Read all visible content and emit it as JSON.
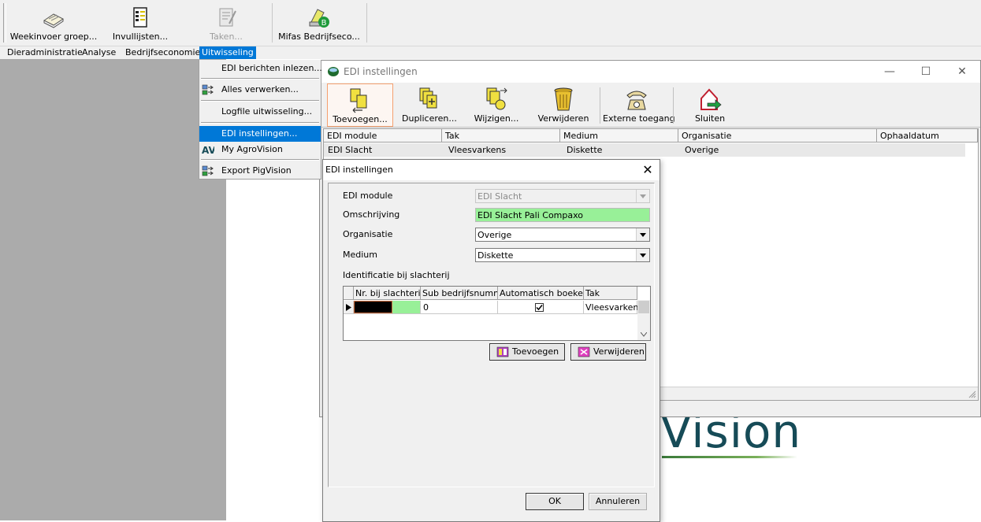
{
  "main_toolbar": {
    "buttons": [
      {
        "label": "Weekinvoer groep...",
        "icon": "book-icon",
        "enabled": true
      },
      {
        "label": "Invullijsten...",
        "icon": "clipboard-list-icon",
        "enabled": true
      },
      {
        "label": "Taken...",
        "icon": "notepad-pencil-icon",
        "enabled": false
      },
      {
        "label": "Mifas Bedrijfseco...",
        "icon": "mifas-b-icon",
        "enabled": true
      }
    ]
  },
  "menubar": {
    "items": [
      "Dieradministratie",
      "Analyse",
      "Bedrijfseconomie",
      "Uitwisseling"
    ],
    "active": "Uitwisseling"
  },
  "dropdown": {
    "items": [
      {
        "label": "EDI berichten inlezen...",
        "icon": ""
      },
      {
        "label": "Alles verwerken...",
        "icon": "process-icon"
      },
      {
        "label": "Logfile uitwisseling...",
        "icon": ""
      },
      {
        "label": "EDI instellingen...",
        "icon": "",
        "highlighted": true
      },
      {
        "label": "My AgroVision",
        "icon": "agrovision-av-icon"
      },
      {
        "label": "Export PigVision",
        "icon": "export-icon"
      }
    ]
  },
  "edi_window": {
    "title": "EDI instellingen",
    "toolbar": [
      {
        "label": "Toevoegen...",
        "icon": "add-document-icon"
      },
      {
        "label": "Dupliceren...",
        "icon": "duplicate-icon"
      },
      {
        "label": "Wijzigen...",
        "icon": "edit-icon"
      },
      {
        "label": "Verwijderen",
        "icon": "trash-bin-icon"
      },
      {
        "label": "Externe toegang",
        "icon": "telephone-icon"
      },
      {
        "label": "Sluiten",
        "icon": "exit-house-icon"
      }
    ],
    "grid": {
      "columns": [
        "EDI module",
        "Tak",
        "Medium",
        "Organisatie",
        "Ophaaldatum"
      ],
      "rows": [
        [
          "EDI Slacht",
          "Vleesvarkens",
          "Diskette",
          "Overige",
          ""
        ]
      ]
    }
  },
  "logo": {
    "text": "Vision"
  },
  "dialog": {
    "title": "EDI instellingen",
    "fields": {
      "edi_module": {
        "label": "EDI module",
        "value": "EDI Slacht"
      },
      "omschrijving": {
        "label": "Omschrijving",
        "value": "EDI Slacht Pali Compaxo"
      },
      "organisatie": {
        "label": "Organisatie",
        "value": "Overige"
      },
      "medium": {
        "label": "Medium",
        "value": "Diskette"
      }
    },
    "identificatie_label": "Identificatie bij slachterij",
    "subgrid": {
      "columns": [
        "Nr. bij slachterij",
        "Sub bedrijfsnummer",
        "Automatisch boeken?",
        "Tak"
      ],
      "rows": [
        {
          "nr": "",
          "sub": "0",
          "auto": true,
          "tak": "Vleesvarkens"
        }
      ]
    },
    "buttons": {
      "toevoegen": "Toevoegen",
      "verwijderen": "Verwijderen",
      "ok": "OK",
      "annuleren": "Annuleren"
    }
  },
  "colors": {
    "menu_highlight": "#0078d7",
    "required_field": "#98f098",
    "logo": "#164b57"
  }
}
